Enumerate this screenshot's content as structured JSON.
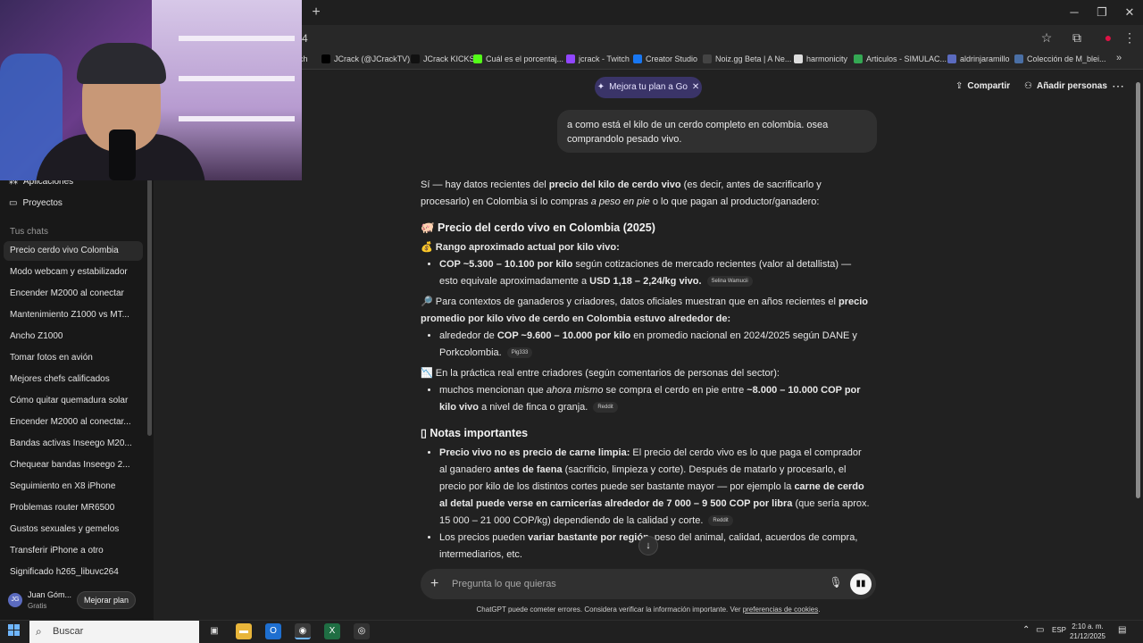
{
  "browser": {
    "address_text": "4",
    "bookmarks": [
      {
        "label": "ch",
        "icon": "none"
      },
      {
        "label": "JCrack (@JCrackTV)...",
        "icon": "x-icon",
        "color": "#000000"
      },
      {
        "label": "JCrack KICKS",
        "icon": "tiktok-icon",
        "color": "#111111"
      },
      {
        "label": "Cuál es el porcentaj...",
        "icon": "kick-icon",
        "color": "#53fc18"
      },
      {
        "label": "jcrack - Twitch",
        "icon": "twitch-icon",
        "color": "#9146ff"
      },
      {
        "label": "Creator Studio",
        "icon": "facebook-icon",
        "color": "#1877f2"
      },
      {
        "label": "Noiz.gg Beta | A Ne...",
        "icon": "noiz-icon",
        "color": "#444444"
      },
      {
        "label": "harmonicity",
        "icon": "page-icon",
        "color": "#dddddd"
      },
      {
        "label": "Articulos - SIMULAC...",
        "icon": "drive-icon",
        "color": "#34a853"
      },
      {
        "label": "aldrinjaramillo",
        "icon": "page-icon",
        "color": "#5b6bbf"
      },
      {
        "label": "Colección de M_blei...",
        "icon": "page-icon",
        "color": "#4a6fa5"
      }
    ]
  },
  "sidebar": {
    "top_items": [
      {
        "label": "Aplicaciones",
        "icon": "apps-icon"
      },
      {
        "label": "Proyectos",
        "icon": "folder-icon"
      }
    ],
    "chats_header": "Tus chats",
    "chats": [
      "Precio cerdo vivo Colombia",
      "Modo webcam y estabilizador",
      "Encender M2000 al conectar",
      "Mantenimiento Z1000 vs MT...",
      "Ancho Z1000",
      "Tomar fotos en avión",
      "Mejores chefs calificados",
      "Cómo quitar quemadura solar",
      "Encender M2000 al conectar...",
      "Bandas activas Inseego M20...",
      "Chequear bandas Inseego 2...",
      "Seguimiento en X8 iPhone",
      "Problemas router MR6500",
      "Gustos sexuales y gemelos",
      "Transferir iPhone a otro",
      "Significado h265_libuvc264"
    ],
    "user": {
      "initials": "JG",
      "name": "Juan Góm...",
      "plan": "Gratis",
      "upgrade_label": "Mejorar plan"
    }
  },
  "header": {
    "plan_pill": "Mejora tu plan a Go",
    "share_label": "Compartir",
    "add_people_label": "Añadir personas"
  },
  "conversation": {
    "user_message": "a como está el kilo de un cerdo completo en colombia. osea comprandolo pesado vivo.",
    "intro_1": "Sí — hay datos recientes del ",
    "intro_bold": "precio del kilo de cerdo vivo",
    "intro_2": " (es decir, antes de sacrificarlo y procesarlo) en Colombia si lo compras ",
    "intro_em": "a peso en pie",
    "intro_3": " o lo que pagan al productor/ganadero:",
    "h1": "🐖 Precio del cerdo vivo en Colombia (2025)",
    "range_label": "💰 Rango aproximado actual por kilo vivo:",
    "b1_bold": "COP ~5.300 – 10.100 por kilo",
    "b1_text": " según cotizaciones de mercado recientes (valor al detallista) — esto equivale aproximadamente a ",
    "b1_bold2": "USD 1,18 – 2,24/kg vivo.",
    "b1_src": "Selina Wamucii",
    "p2_text": "🔎 Para contextos de ganaderos y criadores, datos oficiales muestran que en años recientes el ",
    "p2_bold": "precio promedio por kilo vivo de cerdo en Colombia estuvo alrededor de:",
    "b2_text": "alrededor de ",
    "b2_bold": "COP ~9.600 – 10.000 por kilo",
    "b2_text2": " en promedio nacional en 2024/2025 según DANE y Porkcolombia.",
    "b2_src": "Pig333",
    "p3_text": "📉 En la práctica real entre criadores (según comentarios de personas del sector):",
    "b3_text": "muchos mencionan que ",
    "b3_em": "ahora mismo",
    "b3_text2": " se compra el cerdo en pie entre ",
    "b3_bold": "~8.000 – 10.000 COP por kilo vivo",
    "b3_text3": " a nivel de finca o granja.",
    "b3_src": "Reddit",
    "h2": "▯ Notas importantes",
    "n1_bold": "Precio vivo no es precio de carne limpia:",
    "n1_text": " El precio del cerdo vivo es lo que paga el comprador al ganadero ",
    "n1_bold2": "antes de faena",
    "n1_text2": " (sacrificio, limpieza y corte). Después de matarlo y procesarlo, el precio por kilo de los distintos cortes puede ser bastante mayor — por ejemplo la ",
    "n1_bold3": "carne de cerdo al detal puede verse en carnicerías alrededor de 7 000 – 9 500 COP por libra",
    "n1_text3": " (que sería aprox. 15 000 – 21 000 COP/kg) dependiendo de la calidad y corte.",
    "n1_src": "Reddit",
    "n2_text": "Los precios pueden ",
    "n2_bold": "variar bastante por región",
    "n2_text2": ", peso del animal, calidad, acuerdos de compra, intermediarios, etc."
  },
  "composer": {
    "placeholder": "Pregunta lo que quieras",
    "disclaimer": "ChatGPT puede cometer errores. Considera verificar la información importante. Ver ",
    "disclaimer_link": "preferencias de cookies",
    "disclaimer_end": "."
  },
  "taskbar": {
    "search_placeholder": "Buscar",
    "lang": "ESP",
    "time": "2:10 a. m.",
    "date": "21/12/2025"
  },
  "colors": {
    "accent_pill": "#3a3468",
    "background": "#212121",
    "sidebar": "#181818"
  }
}
